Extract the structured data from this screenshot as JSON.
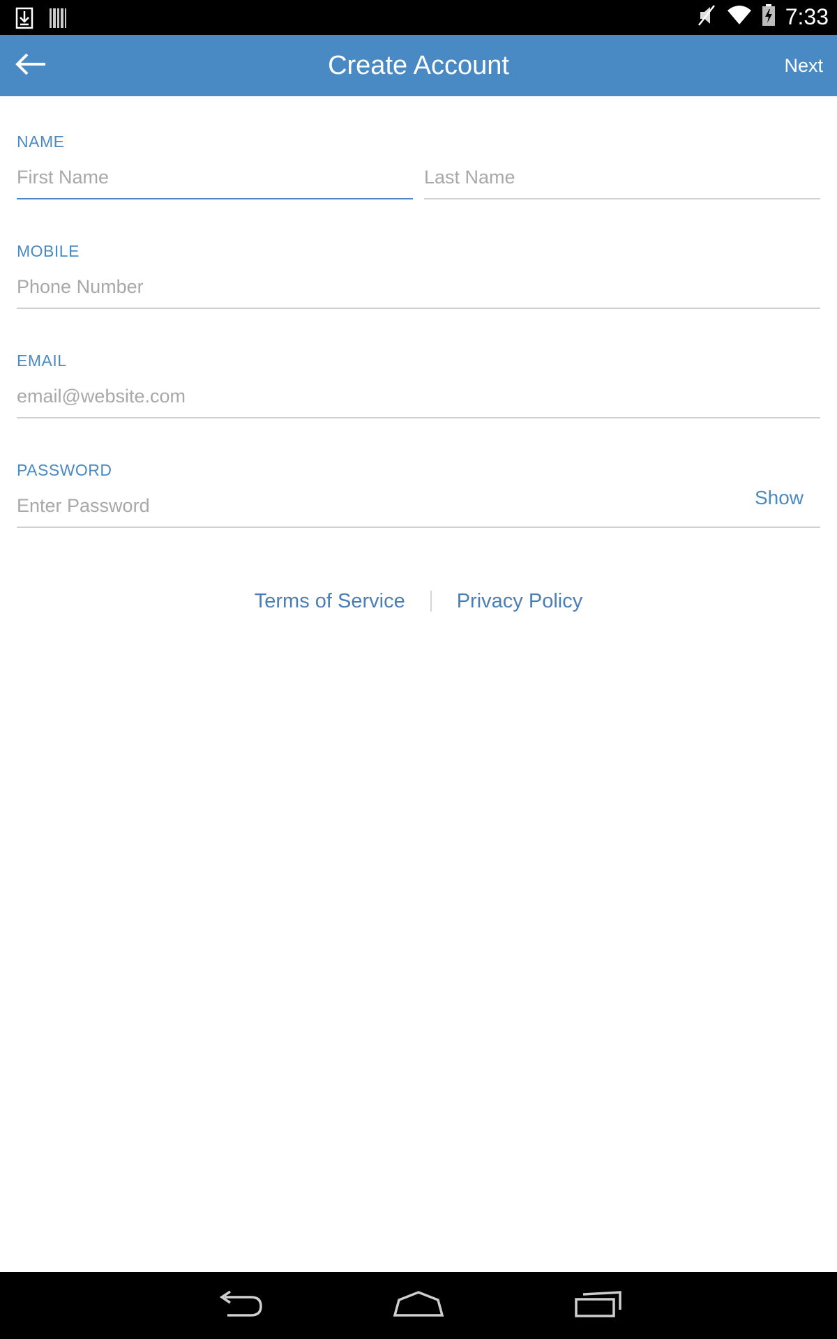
{
  "status_bar": {
    "time": "7:33",
    "left_icons": [
      "download-icon",
      "barcode-icon"
    ],
    "right_icons": [
      "mute-icon",
      "wifi-icon",
      "battery-charging-icon"
    ]
  },
  "app_bar": {
    "title": "Create Account",
    "next_label": "Next",
    "back_icon": "back-arrow-icon",
    "background": "#4a8ac4"
  },
  "form": {
    "name": {
      "label": "NAME",
      "first_placeholder": "First Name",
      "last_placeholder": "Last Name"
    },
    "mobile": {
      "label": "MOBILE",
      "placeholder": "Phone Number"
    },
    "email": {
      "label": "EMAIL",
      "placeholder": "email@website.com"
    },
    "password": {
      "label": "PASSWORD",
      "placeholder": "Enter Password",
      "show_label": "Show"
    }
  },
  "links": {
    "terms": "Terms of Service",
    "privacy": "Privacy Policy"
  },
  "nav_bar": {
    "buttons": [
      "back-icon",
      "home-icon",
      "recent-apps-icon"
    ]
  },
  "colors": {
    "accent": "#4a8ac4",
    "placeholder": "#a8a8a8",
    "divider": "#d0d0d0"
  }
}
